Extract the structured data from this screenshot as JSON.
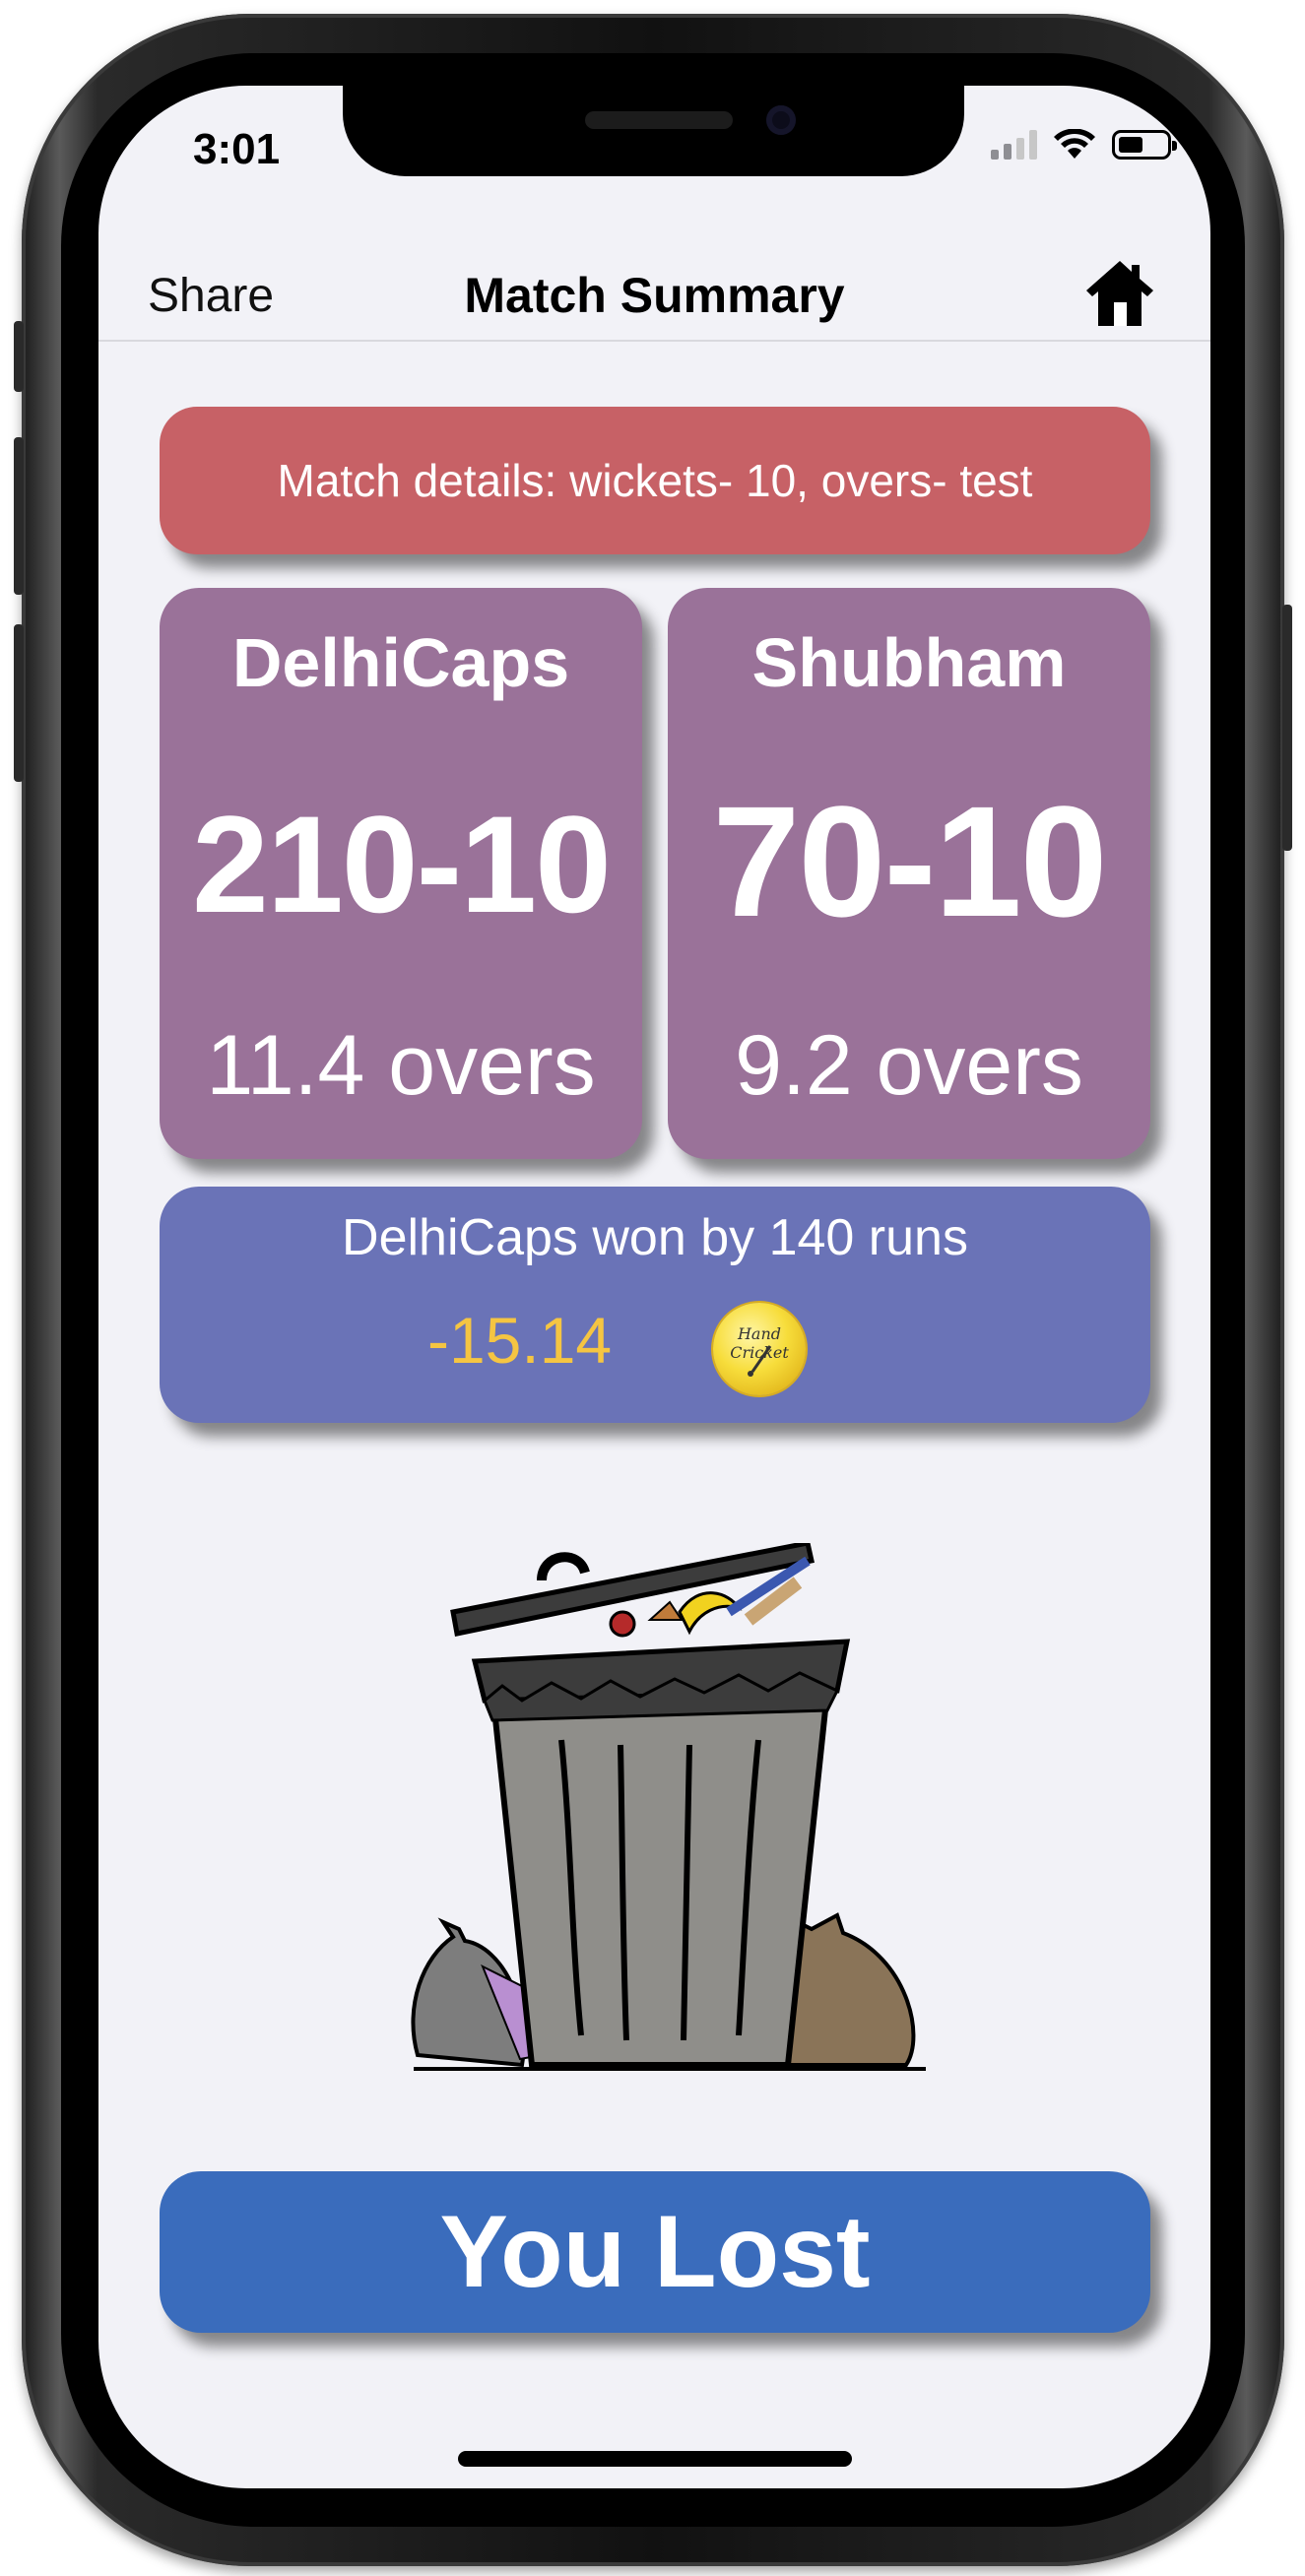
{
  "status_bar": {
    "time": "3:01"
  },
  "nav": {
    "share_label": "Share",
    "title": "Match Summary",
    "home_icon": "home-icon"
  },
  "match": {
    "details": "Match details: wickets- 10, overs- test",
    "team_a": {
      "name": "DelhiCaps",
      "score": "210-10",
      "overs": "11.4 overs"
    },
    "team_b": {
      "name": "Shubham",
      "score": "70-10",
      "overs": "9.2 overs"
    },
    "result_text": "DelhiCaps won by 140 runs",
    "coins_change": "-15.14",
    "coin_icon": "hand-cricket-coin-icon",
    "coin_label": "Hand Cricket"
  },
  "illustration": {
    "icon": "trash-can-illustration"
  },
  "action": {
    "lost_label": "You Lost"
  },
  "colors": {
    "details_bg": "#c76166",
    "team_bg": "#9a7299",
    "result_bg": "#6a73b7",
    "coins_text": "#f5c542",
    "lost_button_bg": "#3a6cbc"
  }
}
